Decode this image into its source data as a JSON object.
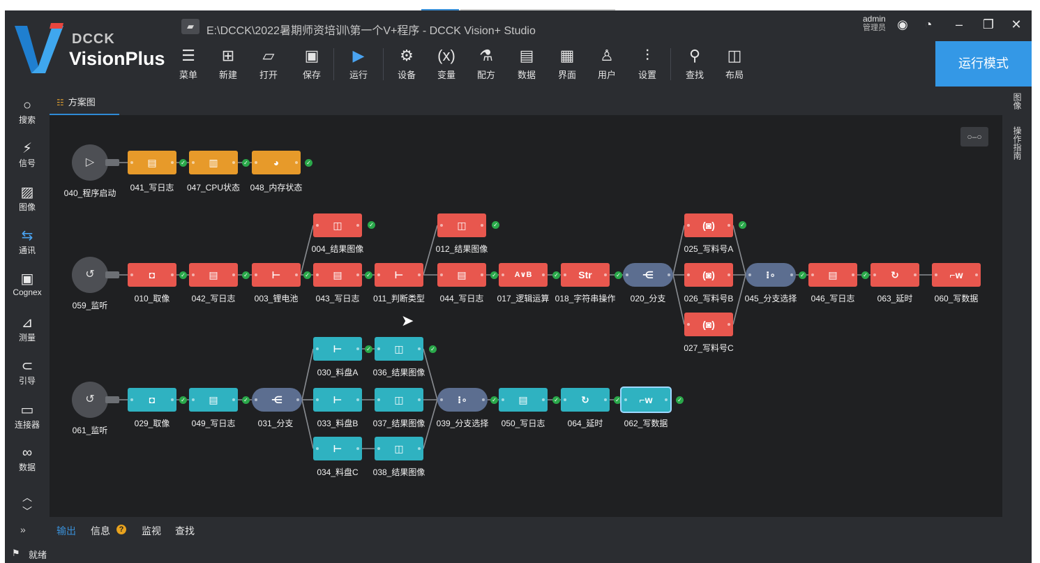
{
  "window": {
    "title": "E:\\DCCK\\2022暑期师资培训\\第一个V+程序 - DCCK Vision+ Studio",
    "brand_small": "DCCK",
    "brand_big": "VisionPlus",
    "user_name": "admin",
    "user_role": "管理员"
  },
  "toolbar": {
    "items": [
      {
        "label": "菜单",
        "icon": "menu-icon"
      },
      {
        "label": "新建",
        "icon": "new-icon"
      },
      {
        "label": "打开",
        "icon": "open-icon"
      },
      {
        "label": "保存",
        "icon": "save-icon"
      },
      {
        "label": "运行",
        "icon": "run-icon"
      },
      {
        "label": "设备",
        "icon": "device-icon"
      },
      {
        "label": "变量",
        "icon": "variable-icon"
      },
      {
        "label": "配方",
        "icon": "recipe-icon"
      },
      {
        "label": "数据",
        "icon": "data-icon"
      },
      {
        "label": "界面",
        "icon": "ui-icon"
      },
      {
        "label": "用户",
        "icon": "user-icon"
      },
      {
        "label": "设置",
        "icon": "settings-icon"
      },
      {
        "label": "查找",
        "icon": "find-icon"
      },
      {
        "label": "布局",
        "icon": "layout-icon"
      }
    ],
    "run_mode": "运行模式"
  },
  "sidebar": {
    "items": [
      {
        "label": "搜索",
        "icon": "search-icon"
      },
      {
        "label": "信号",
        "icon": "signal-icon"
      },
      {
        "label": "图像",
        "icon": "image-icon"
      },
      {
        "label": "通讯",
        "icon": "comm-icon"
      },
      {
        "label": "Cognex",
        "icon": "cognex-icon"
      },
      {
        "label": "测量",
        "icon": "measure-icon"
      },
      {
        "label": "引导",
        "icon": "guide-icon"
      },
      {
        "label": "连接器",
        "icon": "connector-icon"
      },
      {
        "label": "数据",
        "icon": "data-grid-icon"
      }
    ]
  },
  "tab": {
    "label": "方案图"
  },
  "right_rail": {
    "items": [
      "图像",
      "操作指南"
    ]
  },
  "bottom": {
    "tabs": [
      "输出",
      "信息",
      "监视",
      "查找"
    ],
    "status": "就绪"
  },
  "flow": {
    "row1": {
      "start": "040_程序启动",
      "nodes": [
        "041_写日志",
        "047_CPU状态",
        "048_内存状态"
      ]
    },
    "row2": {
      "start": "059_监听",
      "nodes": [
        "010_取像",
        "042_写日志",
        "003_锂电池",
        "043_写日志",
        "011_判断类型",
        "044_写日志",
        "017_逻辑运算",
        "018_字符串操作",
        "020_分支",
        "026_写料号B",
        "045_分支选择",
        "046_写日志",
        "063_延时",
        "060_写数据"
      ],
      "branch_upper": [
        "004_结果图像",
        "012_结果图像",
        "025_写料号A"
      ],
      "branch_lower": [
        "027_写料号C"
      ],
      "node_text_logic": "A∨B",
      "node_text_str": "Str"
    },
    "row3": {
      "start": "061_监听",
      "nodes": [
        "029_取像",
        "049_写日志",
        "031_分支",
        "033_料盘B",
        "037_结果图像",
        "039_分支选择",
        "050_写日志",
        "064_延时",
        "062_写数据"
      ],
      "branch_upper": [
        "030_料盘A",
        "036_结果图像"
      ],
      "branch_lower": [
        "034_料盘C",
        "038_结果图像"
      ]
    }
  }
}
